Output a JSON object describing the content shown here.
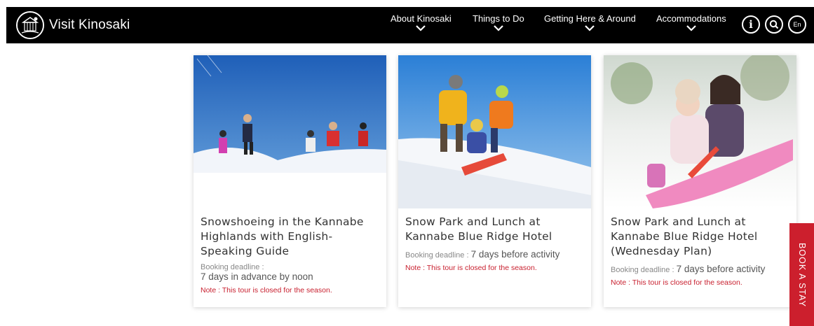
{
  "header": {
    "logo_text": "Visit Kinosaki",
    "nav": [
      {
        "label": "About Kinosaki"
      },
      {
        "label": "Things to Do"
      },
      {
        "label": "Getting Here & Around"
      },
      {
        "label": "Accommodations"
      }
    ],
    "icons": {
      "info": "i",
      "lang": "En"
    }
  },
  "cards": [
    {
      "title": "Snowshoeing in the Kannabe Highlands with English-Speaking Guide",
      "deadline_label": "Booking deadline :",
      "deadline_value": "7 days in advance by noon",
      "note": "Note : This tour is closed for the season."
    },
    {
      "title": "Snow Park and Lunch at Kannabe Blue Ridge Hotel",
      "deadline_label": "Booking deadline : ",
      "deadline_value": "7 days before activity",
      "note": "Note : This tour is closed for the season."
    },
    {
      "title": "Snow Park and Lunch at Kannabe Blue Ridge Hotel (Wednesday Plan)",
      "deadline_label": "Booking deadline : ",
      "deadline_value": "7 days before activity",
      "note": "Note : This tour is closed for the season."
    }
  ],
  "book_a_stay": "BOOK A STAY",
  "colors": {
    "header_bg": "#000000",
    "accent_red": "#cc1f2d",
    "note_red": "#c8202f"
  }
}
